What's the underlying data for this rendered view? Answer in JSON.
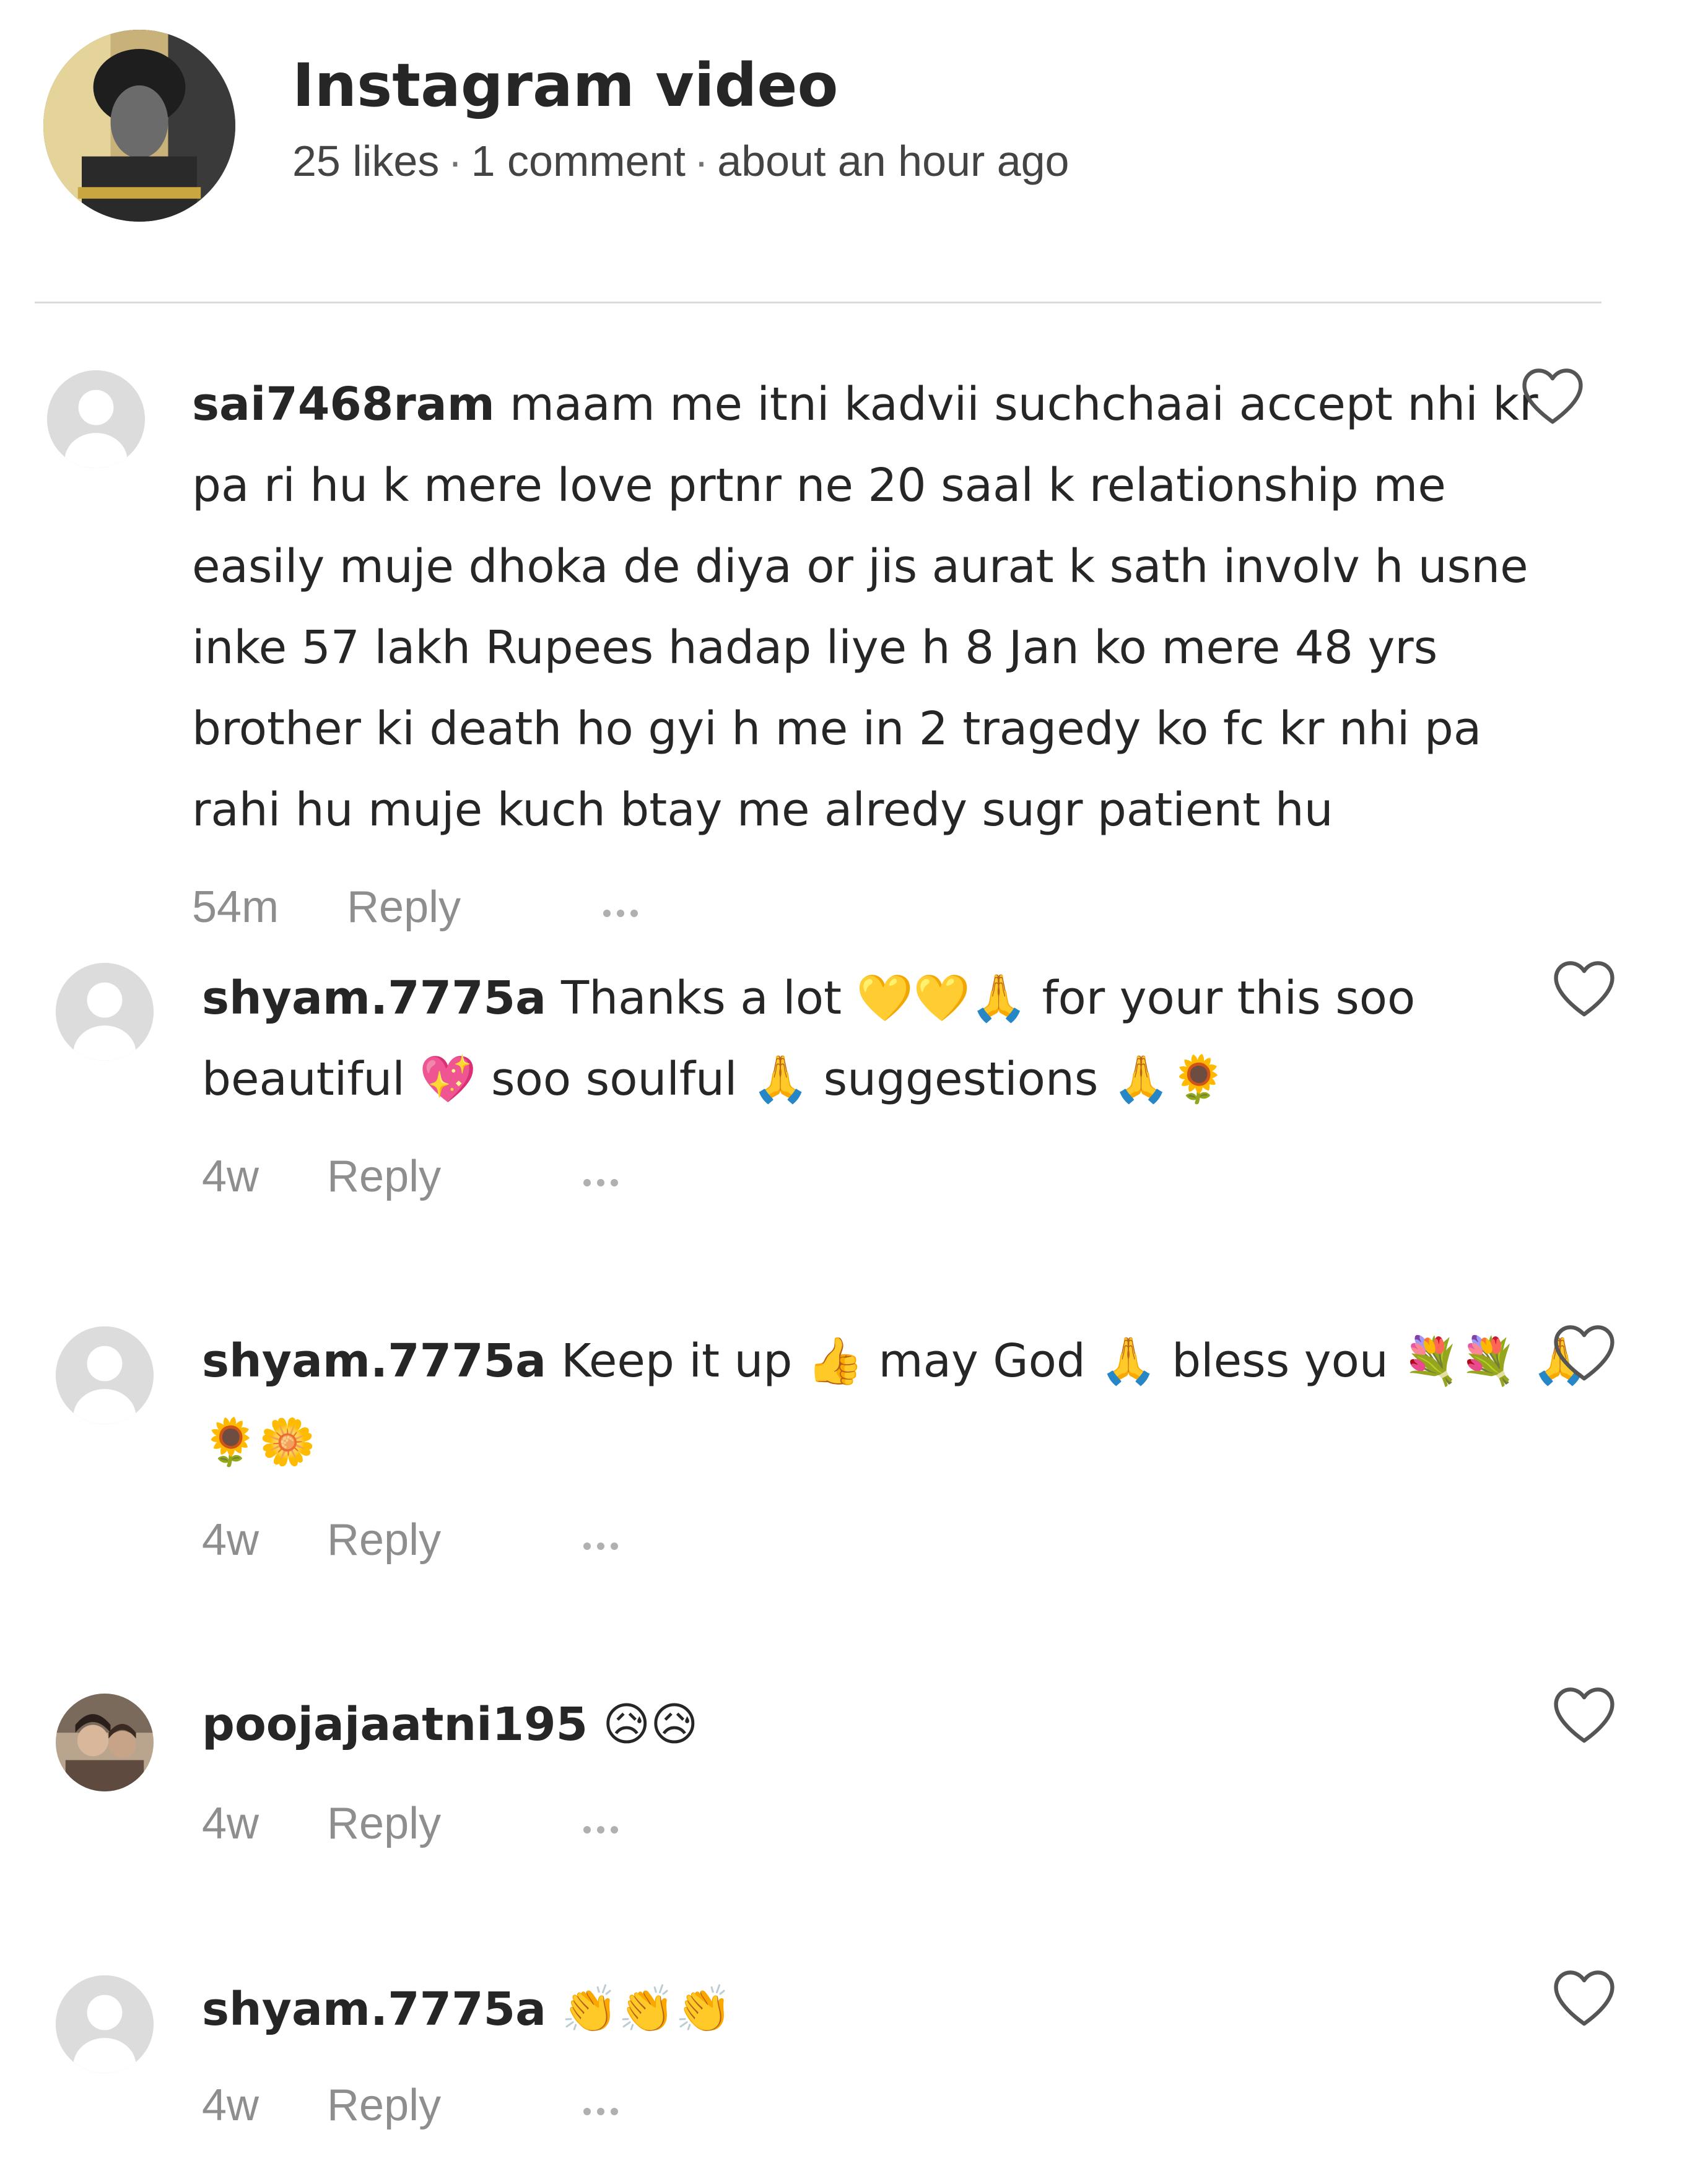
{
  "post": {
    "title": "Instagram video",
    "likes": "25 likes",
    "comments_count": "1 comment",
    "time": "about an hour ago",
    "separator": "·"
  },
  "comments": [
    {
      "username": "sai7468ram",
      "text": "maam me itni kadvii suchchaai accept nhi kr pa ri hu k mere love prtnr ne 20 saal k relationship me easily muje dhoka de diya or jis aurat k sath involv h usne inke 57 lakh Rupees hadap liye h 8 Jan ko mere 48 yrs brother ki death ho gyi h me in 2 tragedy ko fc kr nhi pa rahi hu muje kuch btay me alredy sugr patient hu",
      "time": "54m",
      "reply": "Reply"
    },
    {
      "username": "shyam.7775a",
      "text": "Thanks a lot 💛💛🙏 for your this soo beautiful 💖 soo soulful 🙏 suggestions 🙏🌻",
      "time": "4w",
      "reply": "Reply"
    },
    {
      "username": "shyam.7775a",
      "text": "Keep it up 👍 may God 🙏 bless you 💐💐 🙏🌻🌼",
      "time": "4w",
      "reply": "Reply"
    },
    {
      "username": "poojajaatni195",
      "text": "😥😥",
      "time": "4w",
      "reply": "Reply"
    },
    {
      "username": "shyam.7775a",
      "text": "👏👏👏",
      "time": "4w",
      "reply": "Reply"
    }
  ],
  "icons": {
    "heart": "heart-outline-icon",
    "more": "more-horizontal-icon",
    "avatar": "default-avatar-icon"
  },
  "colors": {
    "text": "#262626",
    "secondary": "#8e8e8e",
    "divider": "#dbdbdb"
  }
}
